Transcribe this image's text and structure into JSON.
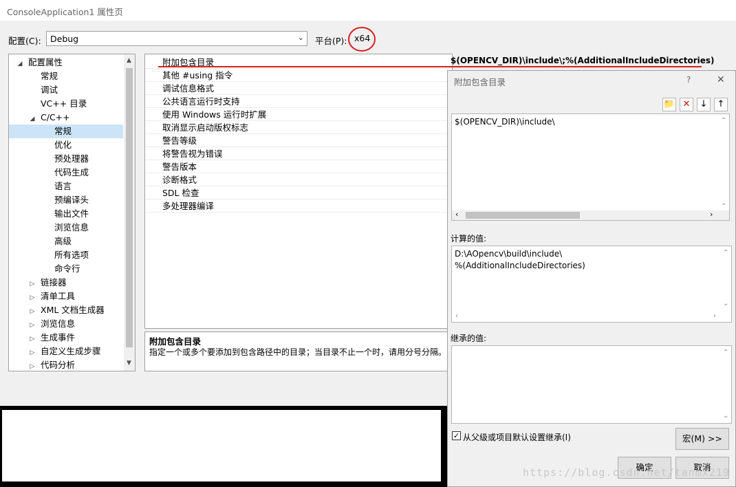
{
  "window": {
    "title": "ConsoleApplication1 属性页"
  },
  "config": {
    "config_label": "配置(C):",
    "config_value": "Debug",
    "platform_label": "平台(P):",
    "platform_value": "x64"
  },
  "tree": {
    "items": [
      {
        "label": "配置属性",
        "level": 0,
        "state": "expanded"
      },
      {
        "label": "常规",
        "level": 1
      },
      {
        "label": "调试",
        "level": 1
      },
      {
        "label": "VC++ 目录",
        "level": 1
      },
      {
        "label": "C/C++",
        "level": 1,
        "state": "expanded"
      },
      {
        "label": "常规",
        "level": 2,
        "selected": true
      },
      {
        "label": "优化",
        "level": 2
      },
      {
        "label": "预处理器",
        "level": 2
      },
      {
        "label": "代码生成",
        "level": 2
      },
      {
        "label": "语言",
        "level": 2
      },
      {
        "label": "预编译头",
        "level": 2
      },
      {
        "label": "输出文件",
        "level": 2
      },
      {
        "label": "浏览信息",
        "level": 2
      },
      {
        "label": "高级",
        "level": 2
      },
      {
        "label": "所有选项",
        "level": 2
      },
      {
        "label": "命令行",
        "level": 2
      },
      {
        "label": "链接器",
        "level": 1,
        "state": "collapsed"
      },
      {
        "label": "清单工具",
        "level": 1,
        "state": "collapsed"
      },
      {
        "label": "XML 文档生成器",
        "level": 1,
        "state": "collapsed"
      },
      {
        "label": "浏览信息",
        "level": 1,
        "state": "collapsed"
      },
      {
        "label": "生成事件",
        "level": 1,
        "state": "collapsed"
      },
      {
        "label": "自定义生成步骤",
        "level": 1,
        "state": "collapsed"
      },
      {
        "label": "代码分析",
        "level": 1,
        "state": "collapsed"
      }
    ]
  },
  "grid": {
    "rows": [
      "附加包含目录",
      "其他 #using 指令",
      "调试信息格式",
      "公共语言运行时支持",
      "使用 Windows 运行时扩展",
      "取消显示启动版权标志",
      "警告等级",
      "将警告视为错误",
      "警告版本",
      "诊断格式",
      "SDL 检查",
      "多处理器编译"
    ],
    "selected_value": "$(OPENCV_DIR)\\include\\;%(AdditionalIncludeDirectories)"
  },
  "description": {
    "title": "附加包含目录",
    "text": "指定一个或多个要添加到包含路径中的目录；当目录不止一个时，请用分号分隔。"
  },
  "dialog": {
    "title": "附加包含目录",
    "help": "?",
    "close": "✕",
    "edit_value": "$(OPENCV_DIR)\\include\\",
    "evaluated_label": "计算的值:",
    "evaluated_lines": [
      "D:\\AOpencv\\build\\include\\",
      "%(AdditionalIncludeDirectories)"
    ],
    "inherited_label": "继承的值:",
    "inherit_checkbox": "从父级或项目默认设置继承(I)",
    "inherit_checked": true,
    "macros_button": "宏(M) >>",
    "ok_button": "确定",
    "cancel_button": "取消"
  },
  "watermark": "https://blog.csdn.net/tanmx219",
  "colors": {
    "annotation_red": "#d81e1e",
    "selection": "#cce4f7"
  },
  "icons": [
    "new-folder-icon",
    "delete-icon",
    "move-down-icon",
    "move-up-icon"
  ]
}
